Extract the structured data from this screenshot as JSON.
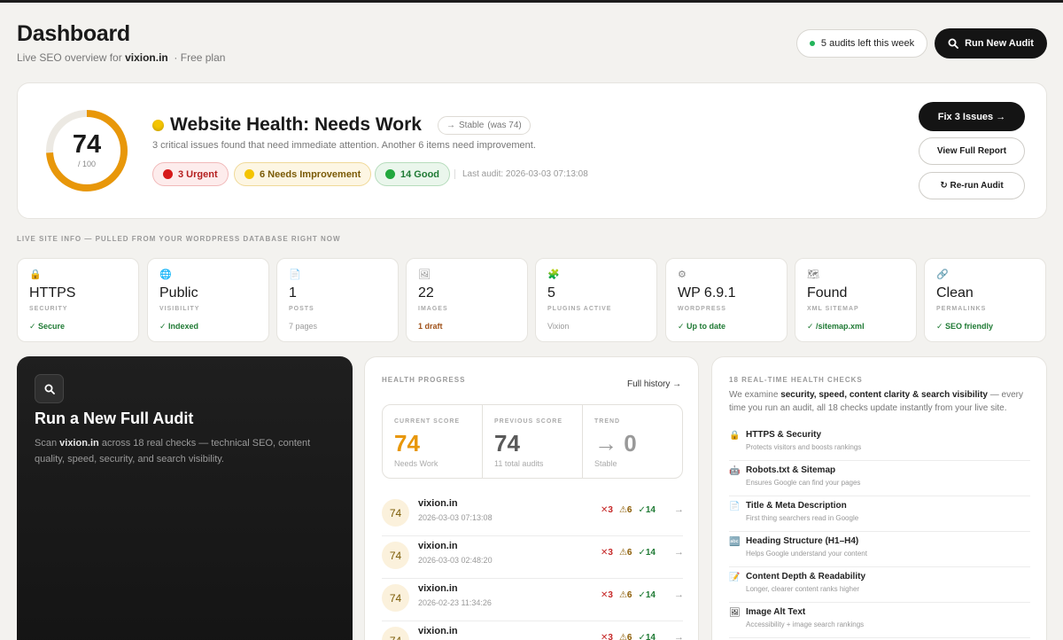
{
  "header": {
    "title": "Dashboard",
    "subtitle_prefix": "Live SEO overview for",
    "site": "vixion.in",
    "plan": "· Free plan",
    "audits_left": "5 audits left this week",
    "run_button": "Run New Audit"
  },
  "health": {
    "score": "74",
    "score_max": "/ 100",
    "score_fraction": 0.74,
    "title": "Website Health: Needs Work",
    "trend_label": "Stable",
    "trend_was": "(was 74)",
    "description": "3 critical issues found that need immediate attention. Another 6 items need improvement.",
    "badges": {
      "urgent": "3 Urgent",
      "improve": "6 Needs Improvement",
      "good": "14 Good"
    },
    "last_audit": "Last audit: 2026-03-03 07:13:08",
    "fix_button": "Fix 3 Issues →",
    "view_button": "View Full Report",
    "rerun_button": "↻ Re-run Audit",
    "colors": {
      "gauge": "#e8970a",
      "track": "#ece9e3"
    }
  },
  "section_label": "LIVE SITE INFO — PULLED FROM YOUR WORDPRESS DATABASE RIGHT NOW",
  "info_cards": [
    {
      "icon": "lock-icon",
      "glyph": "🔒",
      "value": "HTTPS",
      "label": "SECURITY",
      "status": "✓ Secure",
      "status_type": "ok"
    },
    {
      "icon": "globe-icon",
      "glyph": "🌐",
      "value": "Public",
      "label": "VISIBILITY",
      "status": "✓ Indexed",
      "status_type": "ok"
    },
    {
      "icon": "document-icon",
      "glyph": "📄",
      "value": "1",
      "label": "POSTS",
      "status": "7 pages",
      "status_type": "muted"
    },
    {
      "icon": "image-icon",
      "glyph": "🖼",
      "value": "22",
      "label": "IMAGES",
      "status": "1 draft",
      "status_type": "warn"
    },
    {
      "icon": "puzzle-icon",
      "glyph": "🧩",
      "value": "5",
      "label": "PLUGINS ACTIVE",
      "status": "Vixion",
      "status_type": "muted"
    },
    {
      "icon": "gear-icon",
      "glyph": "⚙",
      "value": "WP 6.9.1",
      "label": "WORDPRESS",
      "status": "✓ Up to date",
      "status_type": "ok"
    },
    {
      "icon": "map-icon",
      "glyph": "🗺",
      "value": "Found",
      "label": "XML SITEMAP",
      "status": "✓ /sitemap.xml",
      "status_type": "ok"
    },
    {
      "icon": "link-icon",
      "glyph": "🔗",
      "value": "Clean",
      "label": "PERMALINKS",
      "status": "✓ SEO friendly",
      "status_type": "ok"
    }
  ],
  "audit_card": {
    "title": "Run a New Full Audit",
    "desc_prefix": "Scan",
    "site": "vixion.in",
    "desc_suffix": "across 18 real checks — technical SEO, content quality, speed, security, and search visibility."
  },
  "progress": {
    "label": "HEALTH PROGRESS",
    "history_link": "Full history →",
    "current": {
      "label": "CURRENT SCORE",
      "value": "74",
      "sub": "Needs Work"
    },
    "previous": {
      "label": "PREVIOUS SCORE",
      "value": "74",
      "sub": "11 total audits"
    },
    "trend": {
      "label": "TREND",
      "value": "→ 0",
      "sub": "Stable"
    },
    "audits": [
      {
        "score": "74",
        "site": "vixion.in",
        "date": "2026-03-03 07:13:08",
        "urgent": "✕3",
        "warn": "⚠6",
        "good": "✓14"
      },
      {
        "score": "74",
        "site": "vixion.in",
        "date": "2026-03-03 02:48:20",
        "urgent": "✕3",
        "warn": "⚠6",
        "good": "✓14"
      },
      {
        "score": "74",
        "site": "vixion.in",
        "date": "2026-02-23 11:34:26",
        "urgent": "✕3",
        "warn": "⚠6",
        "good": "✓14"
      },
      {
        "score": "74",
        "site": "vixion.in",
        "date": "",
        "urgent": "✕3",
        "warn": "⚠6",
        "good": "✓14"
      }
    ]
  },
  "checks": {
    "label": "18 REAL-TIME HEALTH CHECKS",
    "desc_prefix": "We examine",
    "desc_bold": "security, speed, content clarity & search visibility",
    "desc_suffix": "— every time you run an audit, all 18 checks update instantly from your live site.",
    "items": [
      {
        "icon": "lock-icon",
        "glyph": "🔒",
        "title": "HTTPS & Security",
        "sub": "Protects visitors and boosts rankings"
      },
      {
        "icon": "robot-icon",
        "glyph": "🤖",
        "title": "Robots.txt & Sitemap",
        "sub": "Ensures Google can find your pages"
      },
      {
        "icon": "document-icon",
        "glyph": "📄",
        "title": "Title & Meta Description",
        "sub": "First thing searchers read in Google"
      },
      {
        "icon": "heading-icon",
        "glyph": "🔤",
        "title": "Heading Structure (H1–H4)",
        "sub": "Helps Google understand your content"
      },
      {
        "icon": "memo-icon",
        "glyph": "📝",
        "title": "Content Depth & Readability",
        "sub": "Longer, clearer content ranks higher"
      },
      {
        "icon": "image-icon",
        "glyph": "🖼",
        "title": "Image Alt Text",
        "sub": "Accessibility + image search rankings"
      }
    ]
  }
}
